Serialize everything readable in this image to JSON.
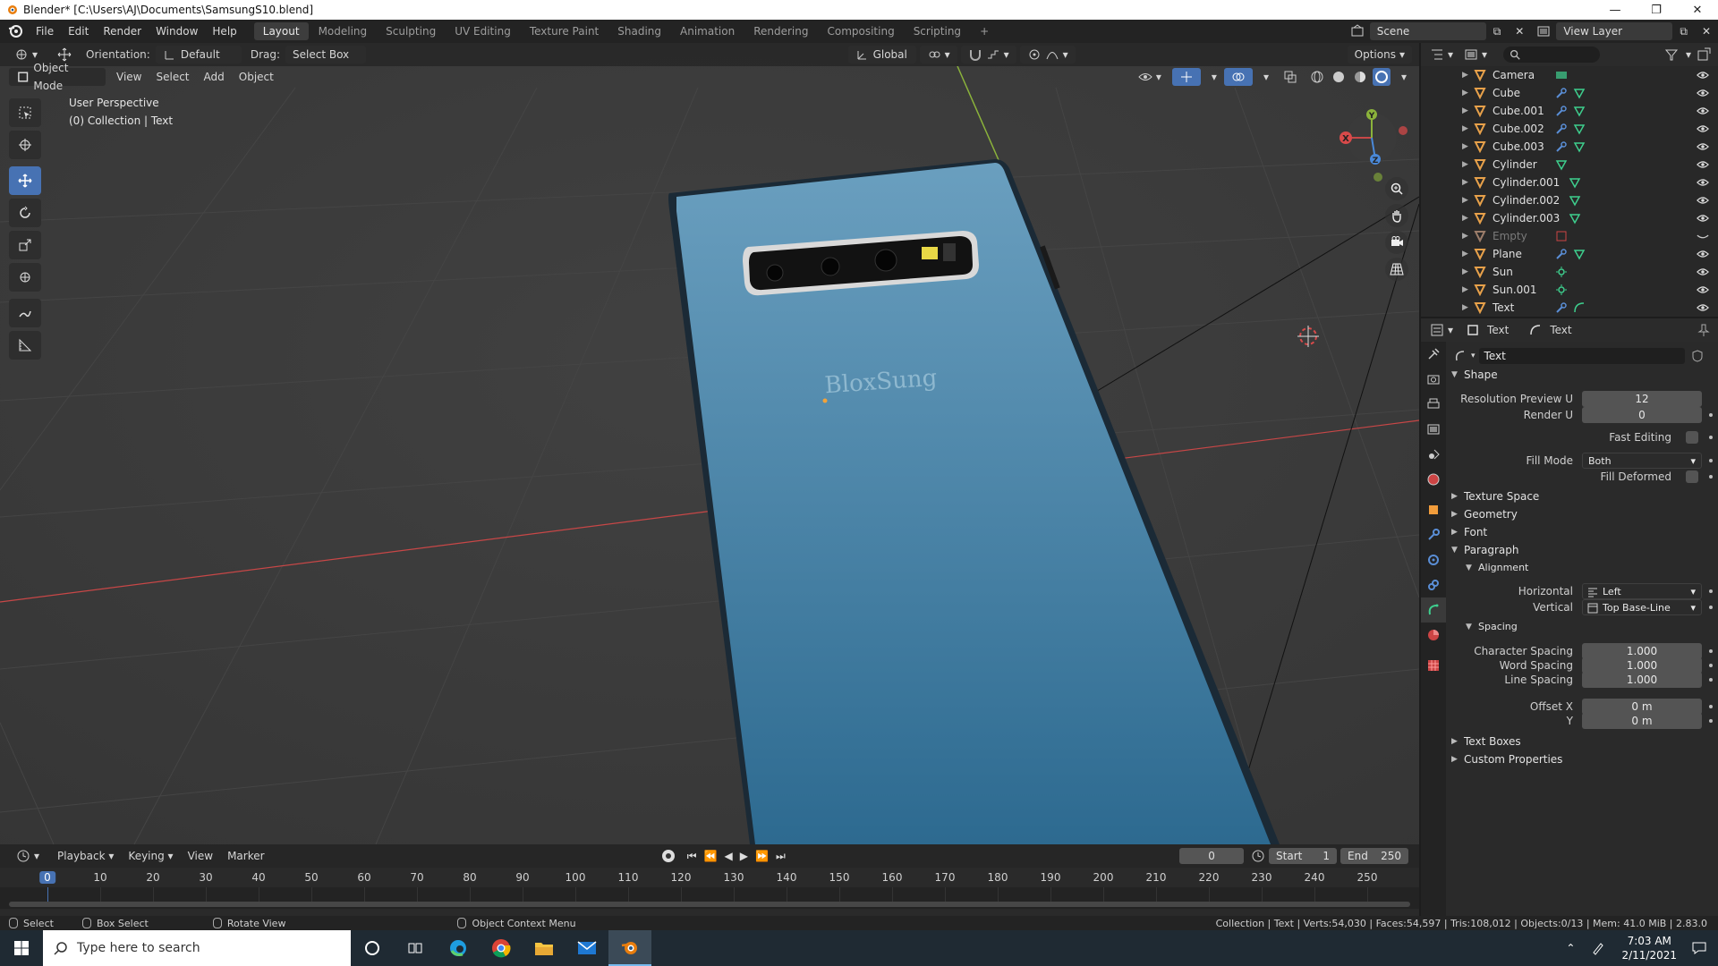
{
  "window": {
    "title": "Blender* [C:\\Users\\AJ\\Documents\\SamsungS10.blend]",
    "controls": [
      "—",
      "❐",
      "✕"
    ]
  },
  "menu": [
    "File",
    "Edit",
    "Render",
    "Window",
    "Help"
  ],
  "workspaces": [
    "Layout",
    "Modeling",
    "Sculpting",
    "UV Editing",
    "Texture Paint",
    "Shading",
    "Animation",
    "Rendering",
    "Compositing",
    "Scripting"
  ],
  "active_workspace": "Layout",
  "add_workspace": "+",
  "scene": "Scene",
  "view_layer": "View Layer",
  "viewport": {
    "orientation_label": "Orientation:",
    "orientation_value": "Default",
    "drag_label": "Drag:",
    "drag_value": "Select Box",
    "transform_space": "Global",
    "options": "Options",
    "mode": "Object Mode",
    "menus": [
      "View",
      "Select",
      "Add",
      "Object"
    ],
    "info_line1": "User Perspective",
    "info_line2": "(0) Collection | Text",
    "phone_text": "BloxSung",
    "gizmo_axes": [
      "X",
      "Y",
      "Z"
    ]
  },
  "outliner": {
    "items": [
      {
        "name": "Camera",
        "type": "camera",
        "mods": [
          "camera-data"
        ],
        "dim": false
      },
      {
        "name": "Cube",
        "type": "mesh",
        "mods": [
          "wrench",
          "mesh-data"
        ],
        "dim": false
      },
      {
        "name": "Cube.001",
        "type": "mesh",
        "mods": [
          "wrench",
          "mesh-data"
        ],
        "dim": false
      },
      {
        "name": "Cube.002",
        "type": "mesh",
        "mods": [
          "wrench",
          "mesh-data"
        ],
        "dim": false
      },
      {
        "name": "Cube.003",
        "type": "mesh",
        "mods": [
          "wrench",
          "mesh-data"
        ],
        "dim": false
      },
      {
        "name": "Cylinder",
        "type": "mesh",
        "mods": [
          "mesh-data"
        ],
        "dim": false
      },
      {
        "name": "Cylinder.001",
        "type": "mesh",
        "mods": [
          "mesh-data"
        ],
        "dim": false
      },
      {
        "name": "Cylinder.002",
        "type": "mesh",
        "mods": [
          "mesh-data"
        ],
        "dim": false
      },
      {
        "name": "Cylinder.003",
        "type": "mesh",
        "mods": [
          "mesh-data"
        ],
        "dim": false
      },
      {
        "name": "Empty",
        "type": "empty",
        "mods": [
          "image-data"
        ],
        "dim": true
      },
      {
        "name": "Plane",
        "type": "mesh",
        "mods": [
          "wrench",
          "mesh-data"
        ],
        "dim": false
      },
      {
        "name": "Sun",
        "type": "light",
        "mods": [
          "light-data"
        ],
        "dim": false
      },
      {
        "name": "Sun.001",
        "type": "light",
        "mods": [
          "light-data"
        ],
        "dim": false
      },
      {
        "name": "Text",
        "type": "text",
        "mods": [
          "wrench",
          "curve-data"
        ],
        "dim": false
      }
    ]
  },
  "properties": {
    "header_object": "Text",
    "header_data": "Text",
    "datablock": "Text",
    "shape_section": "Shape",
    "resolution_preview_label": "Resolution Preview U",
    "resolution_preview_value": "12",
    "render_u_label": "Render U",
    "render_u_value": "0",
    "fast_editing_label": "Fast Editing",
    "fill_mode_label": "Fill Mode",
    "fill_mode_value": "Both",
    "fill_deformed_label": "Fill Deformed",
    "texture_space": "Texture Space",
    "geometry": "Geometry",
    "font": "Font",
    "paragraph": "Paragraph",
    "alignment": "Alignment",
    "horizontal_label": "Horizontal",
    "horizontal_value": "Left",
    "vertical_label": "Vertical",
    "vertical_value": "Top Base-Line",
    "spacing": "Spacing",
    "char_spacing_label": "Character Spacing",
    "char_spacing_value": "1.000",
    "word_spacing_label": "Word Spacing",
    "word_spacing_value": "1.000",
    "line_spacing_label": "Line Spacing",
    "line_spacing_value": "1.000",
    "offset_x_label": "Offset X",
    "offset_x_value": "0 m",
    "offset_y_label": "Y",
    "offset_y_value": "0 m",
    "text_boxes": "Text Boxes",
    "custom_properties": "Custom Properties"
  },
  "timeline": {
    "menus": [
      "Playback",
      "Keying",
      "View",
      "Marker"
    ],
    "current_frame": "0",
    "start_label": "Start",
    "start_value": "1",
    "end_label": "End",
    "end_value": "250",
    "ticks": [
      "0",
      "10",
      "20",
      "30",
      "40",
      "50",
      "60",
      "70",
      "80",
      "90",
      "100",
      "110",
      "120",
      "130",
      "140",
      "150",
      "160",
      "170",
      "180",
      "190",
      "200",
      "210",
      "220",
      "230",
      "240",
      "250"
    ]
  },
  "statusbar": {
    "select": "Select",
    "box_select": "Box Select",
    "rotate_view": "Rotate View",
    "context_menu": "Object Context Menu",
    "stats": "Collection | Text | Verts:54,030 | Faces:54,597 | Tris:108,012 | Objects:0/13 | Mem: 41.0 MiB | 2.83.0"
  },
  "taskbar": {
    "search_placeholder": "Type here to search",
    "time": "7:03 AM",
    "date": "2/11/2021"
  },
  "colors": {
    "accent": "#4772b3",
    "phone_top": "#6a9fbf",
    "phone_bottom": "#2d6a90",
    "x_axis": "#c84747",
    "y_axis": "#8bb33b",
    "z_axis": "#4a89d9"
  }
}
